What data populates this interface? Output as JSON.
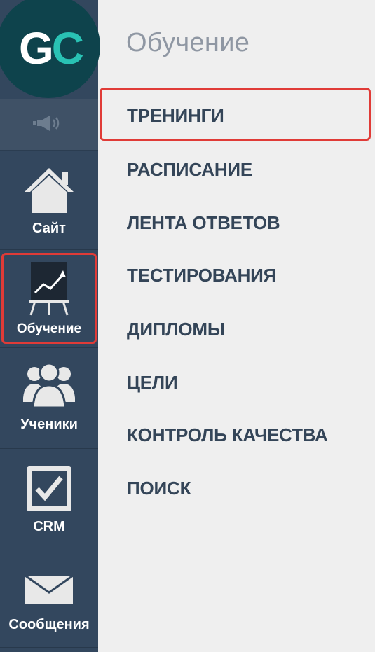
{
  "logo": {
    "letters": [
      "G",
      "C"
    ],
    "colors": {
      "g": "#ffffff",
      "c": "#29c2b4",
      "background": "#0e434c"
    }
  },
  "sidebar": {
    "background": "#33475e",
    "sound_icon": "speaker-icon",
    "items": [
      {
        "label": "Сайт",
        "icon": "house-icon"
      },
      {
        "label": "Обучение",
        "icon": "chart-board-icon",
        "active": true
      },
      {
        "label": "Ученики",
        "icon": "users-icon"
      },
      {
        "label": "CRM",
        "icon": "checkbox-icon"
      },
      {
        "label": "Сообщения",
        "icon": "envelope-icon"
      }
    ]
  },
  "submenu": {
    "title": "Обучение",
    "items": [
      {
        "label": "ТРЕНИНГИ",
        "highlighted": true
      },
      {
        "label": "РАСПИСАНИЕ"
      },
      {
        "label": "ЛЕНТА ОТВЕТОВ"
      },
      {
        "label": "ТЕСТИРОВАНИЯ"
      },
      {
        "label": "ДИПЛОМЫ"
      },
      {
        "label": "ЦЕЛИ"
      },
      {
        "label": "КОНТРОЛЬ КАЧЕСТВА"
      },
      {
        "label": "ПОИСК"
      }
    ]
  },
  "colors": {
    "highlight_border": "#e03b37",
    "menu_text": "#344558",
    "title_text": "#8f97a3"
  }
}
